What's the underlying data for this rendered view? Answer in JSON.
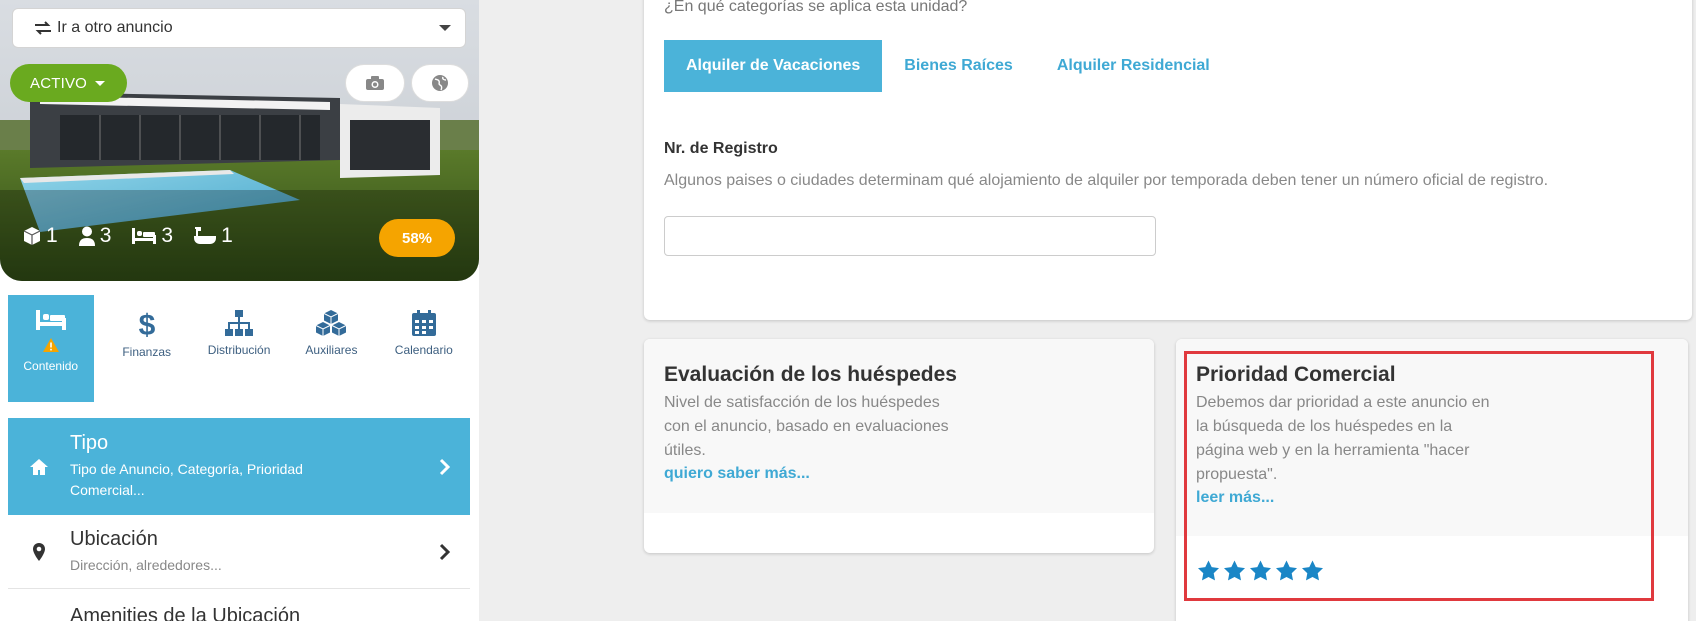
{
  "listing_selector": {
    "label": "Ir a otro anuncio"
  },
  "status": {
    "label": "ACTIVO",
    "color": "#6aaa1f"
  },
  "stats": {
    "units": "1",
    "guests": "3",
    "beds": "3",
    "baths": "1"
  },
  "completion": {
    "label": "58%",
    "percent": 58,
    "color": "#f5a400"
  },
  "tabs": [
    {
      "label": "Contenido",
      "icon": "bed-icon",
      "active": true,
      "warning": true
    },
    {
      "label": "Finanzas",
      "icon": "dollar-icon"
    },
    {
      "label": "Distribución",
      "icon": "sitemap-icon"
    },
    {
      "label": "Auxiliares",
      "icon": "cubes-icon"
    },
    {
      "label": "Calendario",
      "icon": "calendar-icon"
    }
  ],
  "menu": [
    {
      "title": "Tipo",
      "subtitle": "Tipo de Anuncio, Categoría, Prioridad Comercial...",
      "icon": "home-icon",
      "active": true
    },
    {
      "title": "Ubicación",
      "subtitle": "Dirección, alrededores...",
      "icon": "map-marker-icon"
    },
    {
      "title": "Amenities de la Ubicación"
    }
  ],
  "categories": {
    "question": "¿En qué categorías se aplica esta unidad?",
    "options": [
      "Alquiler de Vacaciones",
      "Bienes Raíces",
      "Alquiler Residencial"
    ],
    "selected": "Alquiler de Vacaciones"
  },
  "registration": {
    "label": "Nr. de Registro",
    "help": "Algunos paises o ciudades determinam qué alojamiento de alquiler por temporada deben tener un número oficial de registro.",
    "value": ""
  },
  "guest_rating": {
    "title": "Evaluación de los huéspedes",
    "description": "Nivel de satisfacción de los huéspedes con el anuncio, basado en evaluaciones útiles.",
    "link": "quiero saber más..."
  },
  "priority": {
    "title": "Prioridad Comercial",
    "description": "Debemos dar prioridad a este anuncio en la búsqueda de los huéspedes en la página web y en la herramienta \"hacer propuesta\".",
    "link": "leer más...",
    "stars": 5,
    "star_color": "#1a86c6"
  },
  "colors": {
    "accent": "#4bb3d9",
    "link": "#3fa9d4",
    "highlight": "#e0393e"
  }
}
